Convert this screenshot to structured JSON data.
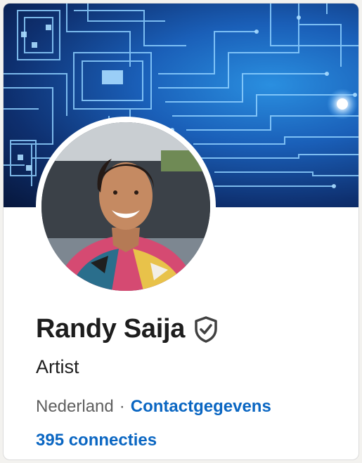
{
  "profile": {
    "name": "Randy Saija",
    "verified_icon": "shield-check-icon",
    "headline": "Artist",
    "location": "Nederland",
    "separator": "·",
    "contact_link": "Contactgegevens",
    "connections": "395 connecties"
  },
  "banner": {
    "theme": "blue circuit board",
    "icon": "circuit-board-background"
  },
  "avatar": {
    "icon": "profile-photo"
  },
  "colors": {
    "link": "#0a66c2",
    "text_primary": "#1d1d1d",
    "text_secondary": "#5e5e5e",
    "card_bg": "#ffffff",
    "page_bg": "#f3f2ef"
  }
}
